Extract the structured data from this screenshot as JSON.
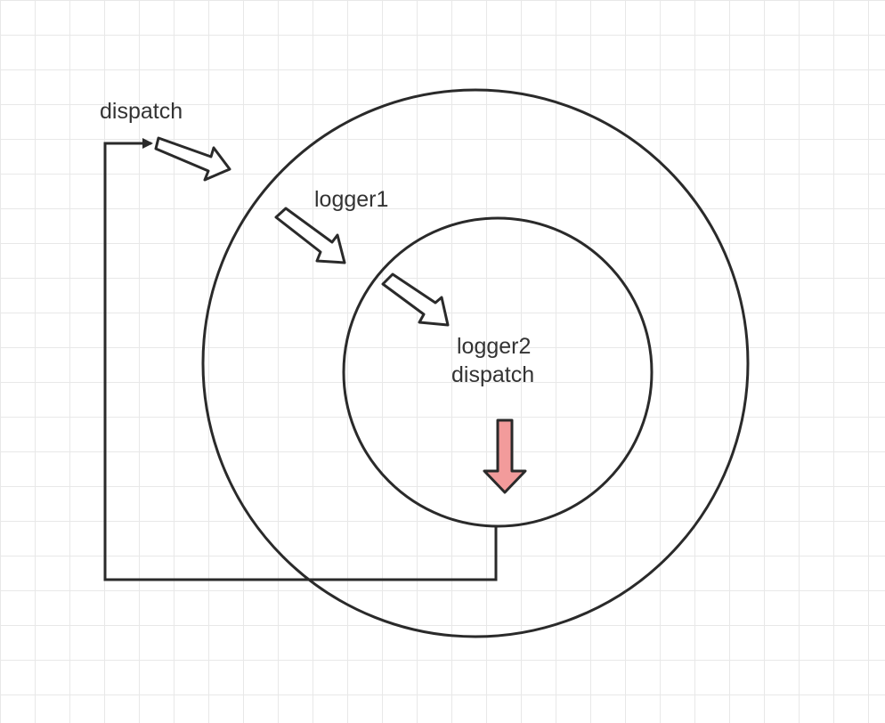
{
  "labels": {
    "outer_dispatch": "dispatch",
    "logger1": "logger1",
    "logger2": "logger2",
    "inner_dispatch": "dispatch"
  },
  "colors": {
    "stroke": "#2a2a2a",
    "highlight_arrow": "#f29b9b",
    "grid": "#e8e8e8",
    "text": "#333333"
  }
}
